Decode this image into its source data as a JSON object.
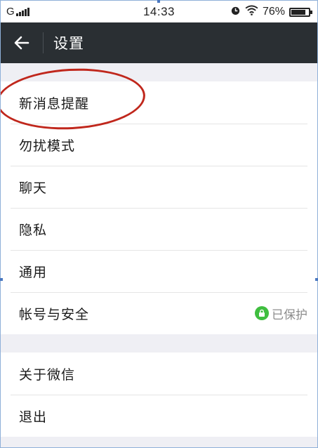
{
  "status_bar": {
    "carrier": "G",
    "time": "14:33",
    "battery": "76%"
  },
  "header": {
    "title": "设置"
  },
  "groups": [
    {
      "items": [
        {
          "label": "新消息提醒"
        },
        {
          "label": "勿扰模式"
        },
        {
          "label": "聊天"
        },
        {
          "label": "隐私"
        },
        {
          "label": "通用"
        },
        {
          "label": "帐号与安全",
          "status": "已保护"
        }
      ]
    },
    {
      "items": [
        {
          "label": "关于微信"
        },
        {
          "label": "退出"
        }
      ]
    }
  ],
  "colors": {
    "header_bg": "#2a2f33",
    "protected_green": "#3fbe3f",
    "annotation_red": "#c0271c"
  }
}
